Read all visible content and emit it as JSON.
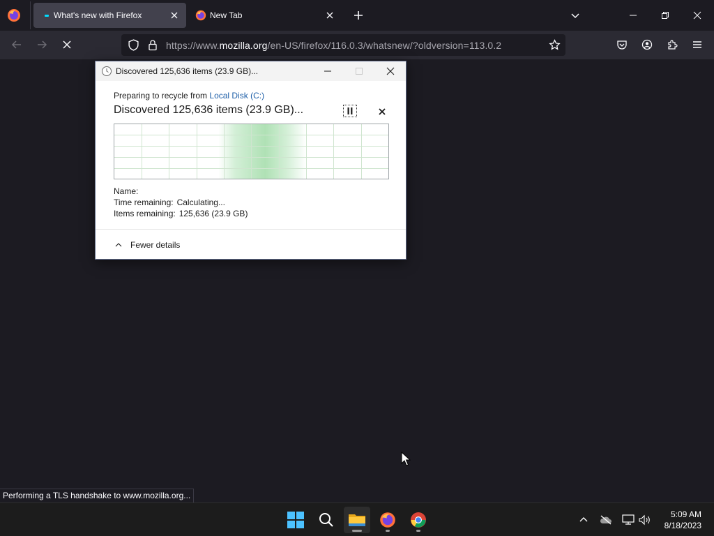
{
  "browser": {
    "tabs": [
      {
        "title": "What's new with Firefox",
        "state": "loading"
      },
      {
        "title": "New Tab",
        "state": "idle"
      }
    ],
    "url": {
      "prefix": "https://www.",
      "host": "mozilla.org",
      "path": "/en-US/firefox/116.0.3/whatsnew/?oldversion=113.0.2"
    },
    "status_text": "Performing a TLS handshake to www.mozilla.org...",
    "icons": {
      "menu": "firefox-logo-icon",
      "new_tab": "plus-icon",
      "list_all_tabs": "chevron-down-icon",
      "back": "arrow-left-icon",
      "forward": "arrow-right-icon",
      "stop": "close-icon",
      "shield": "shield-icon",
      "lock": "lock-icon",
      "bookmark": "star-icon",
      "pocket": "pocket-icon",
      "account": "account-icon",
      "extensions": "puzzle-icon",
      "app_menu": "hamburger-icon"
    }
  },
  "dialog": {
    "title": "Discovered 125,636 items (23.9 GB)...",
    "subline_prefix": "Preparing to recycle from",
    "subline_link": "Local Disk (C:)",
    "headline": "Discovered 125,636 items (23.9 GB)...",
    "details": {
      "name_label": "Name:",
      "name_value": "",
      "time_label": "Time remaining:",
      "time_value": "Calculating...",
      "items_label": "Items remaining:",
      "items_value": "125,636 (23.9 GB)"
    },
    "fewer_details": "Fewer details"
  },
  "taskbar": {
    "apps": [
      "windows-start-icon",
      "search-icon",
      "file-explorer-icon",
      "firefox-icon",
      "chrome-icon"
    ],
    "tray_icons": [
      "chevron-up-icon",
      "onedrive-offline-icon",
      "network-icon",
      "volume-icon"
    ],
    "time": "5:09 AM",
    "date": "8/18/2023"
  },
  "colors": {
    "browser_bg": "#1c1b22",
    "toolbar_bg": "#2b2a33",
    "active_tab": "#42414d",
    "link_blue": "#1e5fa8",
    "graph_green": "#6ec878"
  }
}
